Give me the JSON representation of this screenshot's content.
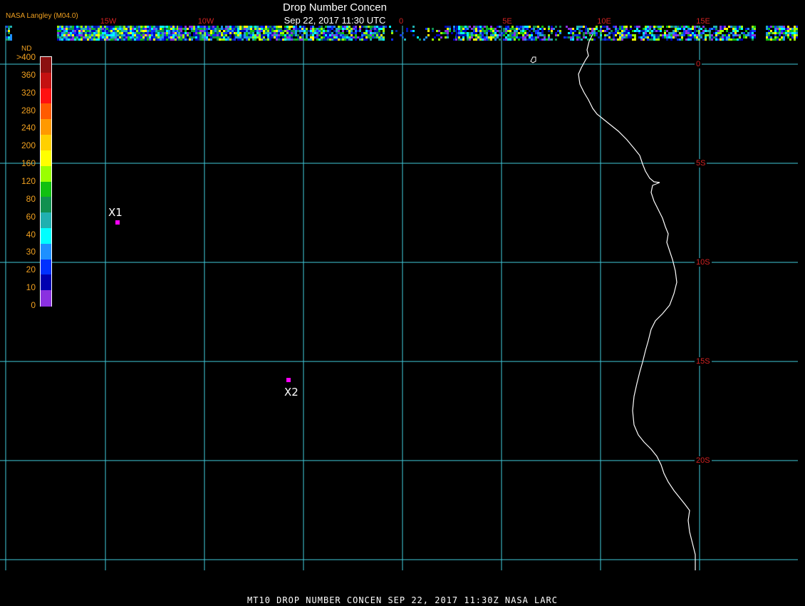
{
  "header": {
    "agency": "NASA Langley (M04.0)",
    "title": "Drop Number Concen",
    "datetime": "Sep 22, 2017 11:30 UTC"
  },
  "footer": {
    "caption": "MT10  DROP NUMBER CONCEN   SEP 22, 2017 11:30Z   NASA LARC"
  },
  "longitude_labels": [
    "15W",
    "10W",
    "0",
    "5E",
    "10E",
    "15E"
  ],
  "latitude_labels": [
    "0",
    "5S",
    "10S",
    "15S",
    "20S"
  ],
  "colorbar": {
    "unit": "ND",
    "labels": [
      ">400",
      "360",
      "320",
      "280",
      "240",
      "200",
      "160",
      "120",
      "80",
      "60",
      "40",
      "30",
      "20",
      "10",
      "0"
    ],
    "colors": [
      "#8b1010",
      "#c41010",
      "#ff1010",
      "#ff5a00",
      "#ff9900",
      "#ffd000",
      "#ffff00",
      "#9aff00",
      "#10c010",
      "#109050",
      "#20b0b0",
      "#00ffff",
      "#1e90ff",
      "#0030ff",
      "#0000b0",
      "#8a30e0"
    ]
  },
  "markers": [
    {
      "label": "X1",
      "color": "#ff00ff"
    },
    {
      "label": "X2",
      "color": "#ff00ff"
    }
  ],
  "grid_color": "#3fc8d8",
  "coast_color": "#ffffff"
}
